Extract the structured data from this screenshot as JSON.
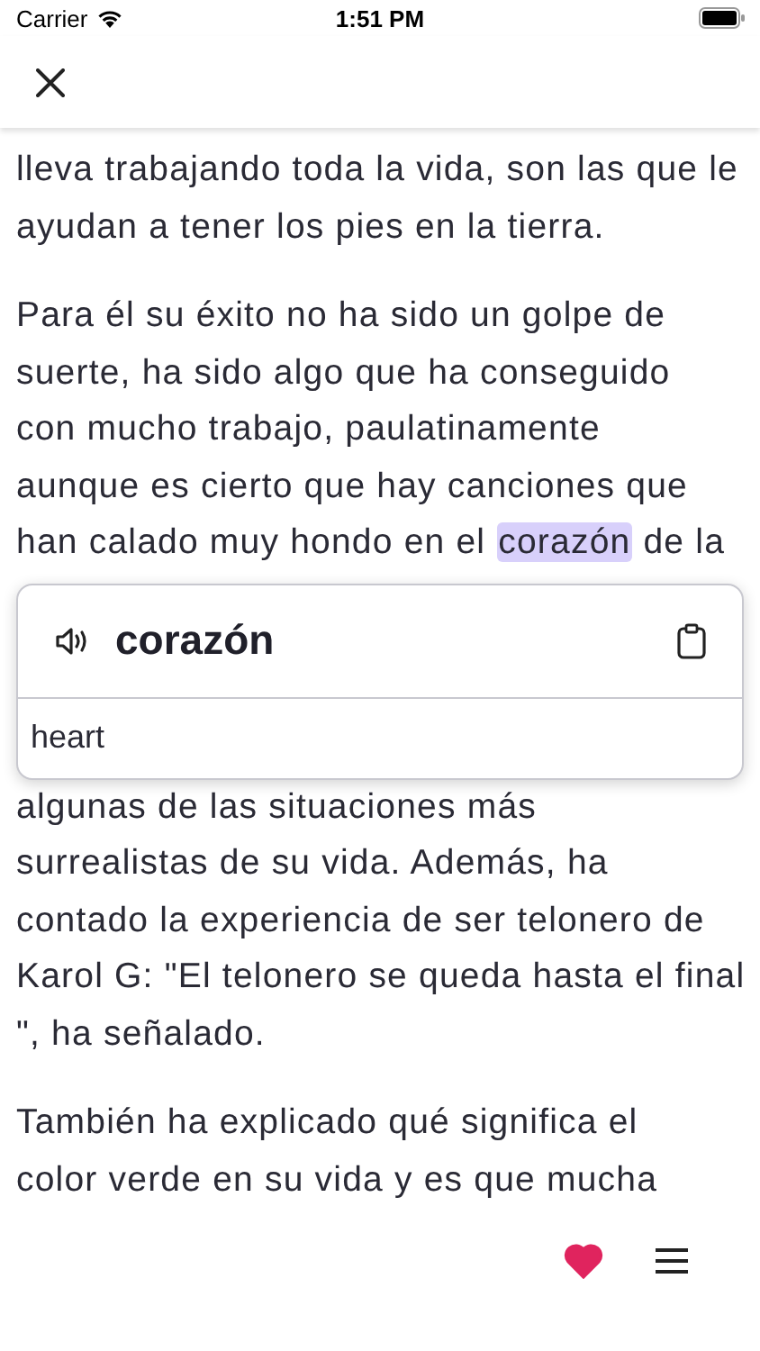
{
  "status_bar": {
    "carrier": "Carrier",
    "time": "1:51 PM"
  },
  "content": [
    {
      "kind": "paragraph",
      "lines": [
        [
          {
            "text": "lleva trabajando toda la vida, son las que le",
            "highlighted": false
          }
        ],
        [
          {
            "text": " ayudan a tener los pies en la tierra.",
            "highlighted": false
          }
        ]
      ]
    },
    {
      "kind": "paragraph",
      "lines": [
        [
          {
            "text": "Para él su éxito no ha sido un golpe de",
            "highlighted": false
          }
        ],
        [
          {
            "text": "suerte, ha sido algo que ha conseguido",
            "highlighted": false
          }
        ],
        [
          {
            "text": "con mucho trabajo, paulatinamente",
            "highlighted": false
          }
        ],
        [
          {
            "text": "aunque es cierto que hay canciones que",
            "highlighted": false
          }
        ],
        [
          {
            "text": "han calado muy hondo en el ",
            "highlighted": false
          },
          {
            "text": "corazón",
            "highlighted": true
          },
          {
            "text": " de la",
            "highlighted": false
          }
        ]
      ]
    },
    {
      "kind": "popup",
      "word": "corazón",
      "translation": "heart"
    },
    {
      "kind": "paragraph",
      "lines": [
        [
          {
            "text": "algunas de las situaciones más",
            "highlighted": false
          }
        ],
        [
          {
            "text": "surrealistas de su vida. Además, ha",
            "highlighted": false
          }
        ],
        [
          {
            "text": "contado la experiencia de ser telonero de",
            "highlighted": false
          }
        ],
        [
          {
            "text": "Karol G: \"El telonero se queda hasta el final",
            "highlighted": false
          }
        ],
        [
          {
            "text": "\", ha señalado.",
            "highlighted": false
          }
        ]
      ]
    },
    {
      "kind": "paragraph",
      "lines": [
        [
          {
            "text": "También ha explicado qué significa el",
            "highlighted": false
          }
        ],
        [
          {
            "text": "color verde en su vida y es que mucha",
            "highlighted": false
          }
        ]
      ]
    }
  ],
  "bottom_bar": {
    "favorite": true
  }
}
